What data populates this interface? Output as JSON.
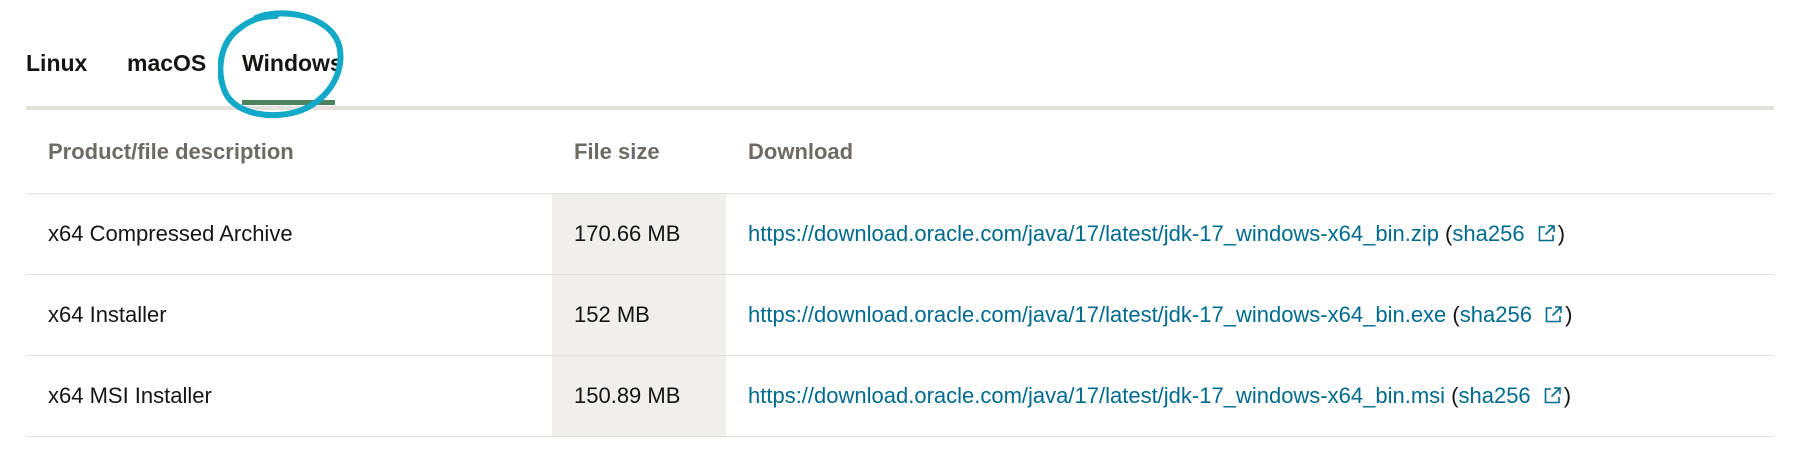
{
  "tabs": [
    {
      "label": "Linux",
      "selected": false
    },
    {
      "label": "macOS",
      "selected": false
    },
    {
      "label": "Windows",
      "selected": true
    }
  ],
  "colors": {
    "link": "#006b8f",
    "selected_tab_underline": "#4c825c",
    "annotation_circle": "#12a8c8",
    "header_text": "#6f6a64",
    "size_column_bg": "#f1efed"
  },
  "table": {
    "headers": [
      "Product/file description",
      "File size",
      "Download"
    ],
    "rows": [
      {
        "description": "x64 Compressed Archive",
        "size": "170.66 MB",
        "url": "https://download.oracle.com/java/17/latest/jdk-17_windows-x64_bin.zip",
        "checksum_label": "sha256",
        "checksum_icon": "external-link-icon"
      },
      {
        "description": "x64 Installer",
        "size": "152 MB",
        "url": "https://download.oracle.com/java/17/latest/jdk-17_windows-x64_bin.exe",
        "checksum_label": "sha256",
        "checksum_icon": "external-link-icon"
      },
      {
        "description": "x64 MSI Installer",
        "size": "150.89 MB",
        "url": "https://download.oracle.com/java/17/latest/jdk-17_windows-x64_bin.msi",
        "checksum_label": "sha256",
        "checksum_icon": "external-link-icon"
      }
    ]
  }
}
